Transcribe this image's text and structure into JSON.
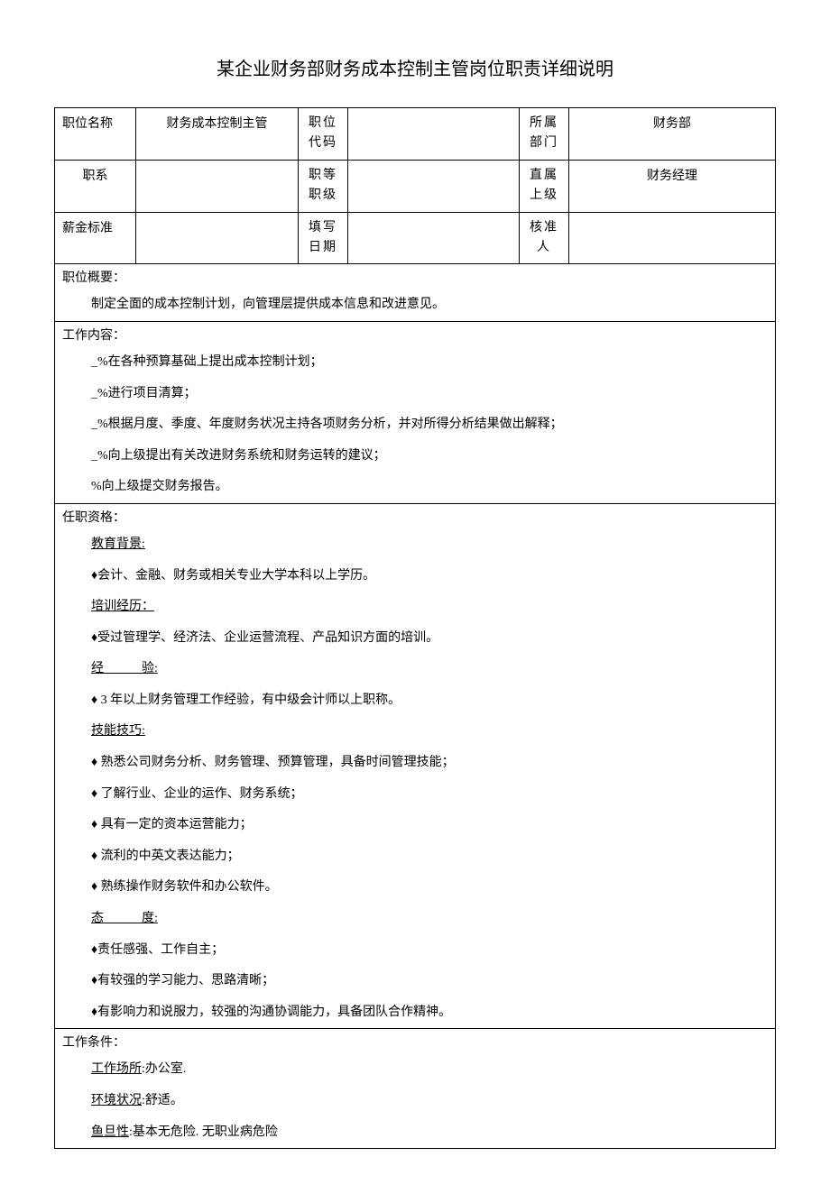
{
  "title": "某企业财务部财务成本控制主管岗位职责详细说明",
  "header": {
    "row1": {
      "c1": "职位名称",
      "c2": "财务成本控制主管",
      "c3": "职位代码",
      "c4": "",
      "c5": "所属部门",
      "c6": "财务部"
    },
    "row2": {
      "c1": "职系",
      "c2": "",
      "c3": "职等职级",
      "c4": "",
      "c5": "直属上级",
      "c6": "财务经理"
    },
    "row3": {
      "c1": "薪金标准",
      "c2": "",
      "c3": "填写日期",
      "c4": "",
      "c5": "核准人",
      "c6": ""
    }
  },
  "overview": {
    "label": "职位概要：",
    "text": "制定全面的成本控制计划，向管理层提供成本信息和改进意见。"
  },
  "work": {
    "label": "工作内容：",
    "lines": [
      "_%在各种预算基础上提出成本控制计划；",
      "_%进行项目清算；",
      "_%根据月度、季度、年度财务状况主持各项财务分析，并对所得分析结果做出解释；",
      "_%向上级提出有关改进财务系统和财务运转的建议；",
      "%向上级提交财务报告。"
    ]
  },
  "qualifications": {
    "label": "任职资格：",
    "edu_label": "教育背景:",
    "edu_items": [
      "♦会计、金融、财务或相关专业大学本科以上学历。"
    ],
    "training_label": "培训经历：",
    "training_items": [
      "♦受过管理学、经济法、企业运营流程、产品知识方面的培训。"
    ],
    "exp_label": "经　　　验:",
    "exp_items": [
      "♦ 3 年以上财务管理工作经验，有中级会计师以上职称。"
    ],
    "skill_label": "技能技巧:",
    "skill_items": [
      "♦ 熟悉公司财务分析、财务管理、预算管理，具备时间管理技能；",
      "♦ 了解行业、企业的运作、财务系统；",
      "♦ 具有一定的资本运营能力；",
      "♦ 流利的中英文表达能力；",
      "♦ 熟练操作财务软件和办公软件。"
    ],
    "attitude_label": "态　　　度:",
    "attitude_items": [
      "♦责任感强、工作自主；",
      "♦有较强的学习能力、思路清晰；",
      "♦有影响力和说服力，较强的沟通协调能力，具备团队合作精神。"
    ]
  },
  "conditions": {
    "label": "工作条件：",
    "place_label": "工作场所",
    "place_text": ":办公室.",
    "env_label": "环境状况",
    "env_text": ":舒适。",
    "risk_label": "鱼旦性",
    "risk_text": ":基本无危险. 无职业病危险"
  }
}
